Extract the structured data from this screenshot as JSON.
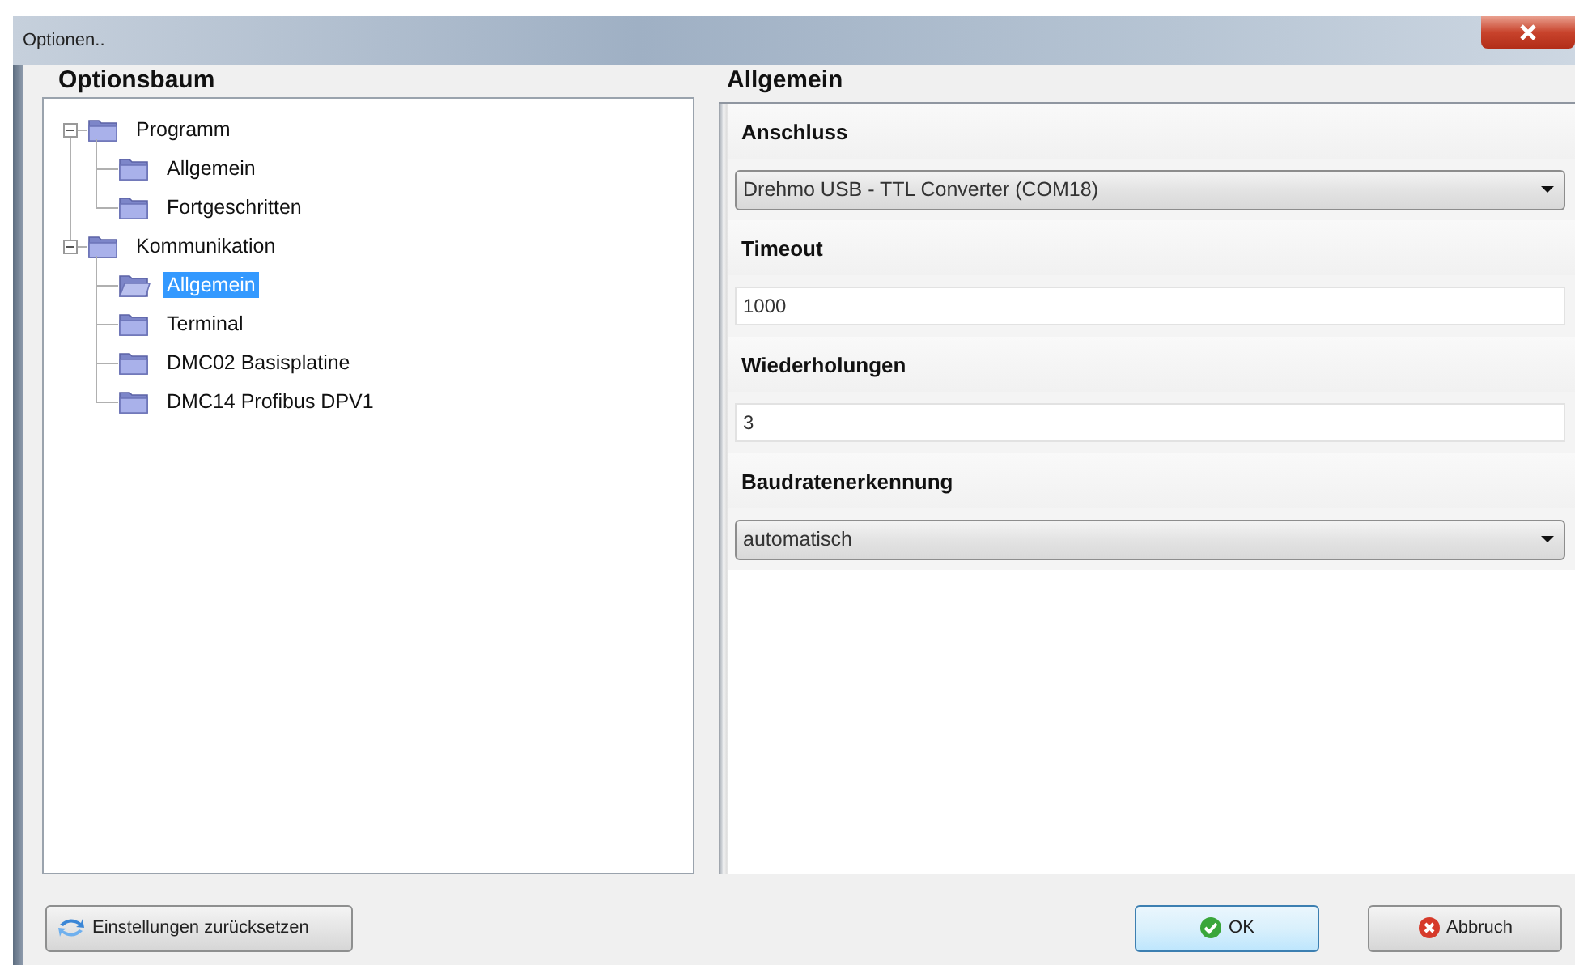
{
  "window": {
    "title": "Optionen.."
  },
  "tree": {
    "title": "Optionsbaum",
    "items": [
      {
        "label": "Programm",
        "expanded": true,
        "selected": false,
        "children": [
          {
            "label": "Allgemein",
            "selected": false
          },
          {
            "label": "Fortgeschritten",
            "selected": false
          }
        ]
      },
      {
        "label": "Kommunikation",
        "expanded": true,
        "selected": false,
        "children": [
          {
            "label": "Allgemein",
            "selected": true
          },
          {
            "label": "Terminal",
            "selected": false
          },
          {
            "label": "DMC02 Basisplatine",
            "selected": false
          },
          {
            "label": "DMC14 Profibus DPV1",
            "selected": false
          }
        ]
      }
    ]
  },
  "settings": {
    "title": "Allgemein",
    "fields": [
      {
        "label": "Anschluss",
        "kind": "dropdown",
        "value": "Drehmo USB - TTL Converter (COM18)"
      },
      {
        "label": "Timeout",
        "kind": "text",
        "value": "1000"
      },
      {
        "label": "Wiederholungen",
        "kind": "text",
        "value": "3"
      },
      {
        "label": "Baudratenerkennung",
        "kind": "dropdown",
        "value": "automatisch"
      }
    ]
  },
  "buttons": {
    "reset": "Einstellungen zurücksetzen",
    "ok": "OK",
    "cancel": "Abbruch"
  }
}
